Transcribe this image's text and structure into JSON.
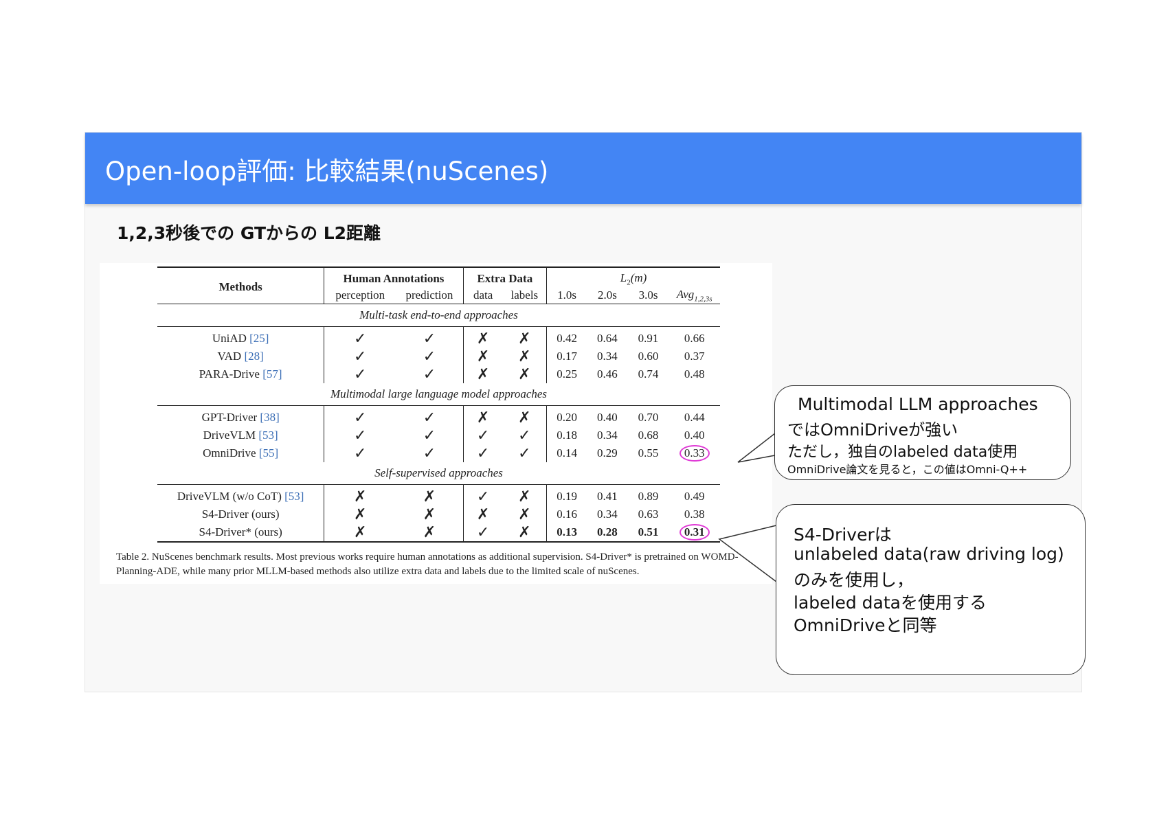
{
  "slide": {
    "title": "Open-loop評価: 比較結果(nuScenes)",
    "subtitle": "1,2,3秒後での GTからの L2距離"
  },
  "table": {
    "header": {
      "methods": "Methods",
      "human_annotations": "Human Annotations",
      "perception": "perception",
      "prediction": "prediction",
      "extra_data": "Extra Data",
      "data": "data",
      "labels": "labels",
      "l2_prefix": "L",
      "l2_sub": "2",
      "l2_suffix": "(m)",
      "t1": "1.0s",
      "t2": "2.0s",
      "t3": "3.0s",
      "avg": "Avg",
      "avg_sub": "1,2,3s"
    },
    "sections": [
      {
        "title": "Multi-task end-to-end approaches",
        "rows": [
          {
            "method": "UniAD ",
            "ref": "[25]",
            "perception": "✓",
            "prediction": "✓",
            "data": "✗",
            "labels": "✗",
            "t1": "0.42",
            "t2": "0.64",
            "t3": "0.91",
            "avg": "0.66"
          },
          {
            "method": "VAD ",
            "ref": "[28]",
            "perception": "✓",
            "prediction": "✓",
            "data": "✗",
            "labels": "✗",
            "t1": "0.17",
            "t2": "0.34",
            "t3": "0.60",
            "avg": "0.37"
          },
          {
            "method": "PARA-Drive ",
            "ref": "[57]",
            "perception": "✓",
            "prediction": "✓",
            "data": "✗",
            "labels": "✗",
            "t1": "0.25",
            "t2": "0.46",
            "t3": "0.74",
            "avg": "0.48"
          }
        ]
      },
      {
        "title": "Multimodal large language model approaches",
        "rows": [
          {
            "method": "GPT-Driver ",
            "ref": "[38]",
            "perception": "✓",
            "prediction": "✓",
            "data": "✗",
            "labels": "✗",
            "t1": "0.20",
            "t2": "0.40",
            "t3": "0.70",
            "avg": "0.44"
          },
          {
            "method": "DriveVLM ",
            "ref": "[53]",
            "perception": "✓",
            "prediction": "✓",
            "data": "✓",
            "labels": "✓",
            "t1": "0.18",
            "t2": "0.34",
            "t3": "0.68",
            "avg": "0.40"
          },
          {
            "method": "OmniDrive ",
            "ref": "[55]",
            "perception": "✓",
            "prediction": "✓",
            "data": "✓",
            "labels": "✓",
            "t1": "0.14",
            "t2": "0.29",
            "t3": "0.55",
            "avg": "0.33"
          }
        ]
      },
      {
        "title": "Self-supervised approaches",
        "rows": [
          {
            "method": "DriveVLM (w/o CoT) ",
            "ref": "[53]",
            "perception": "✗",
            "prediction": "✗",
            "data": "✓",
            "labels": "✗",
            "t1": "0.19",
            "t2": "0.41",
            "t3": "0.89",
            "avg": "0.49"
          },
          {
            "method": "S4-Driver (ours)",
            "ref": "",
            "perception": "✗",
            "prediction": "✗",
            "data": "✗",
            "labels": "✗",
            "t1": "0.16",
            "t2": "0.34",
            "t3": "0.63",
            "avg": "0.38"
          },
          {
            "method": "S4-Driver* (ours)",
            "ref": "",
            "perception": "✗",
            "prediction": "✗",
            "data": "✓",
            "labels": "✗",
            "t1": "0.13",
            "t2": "0.28",
            "t3": "0.51",
            "avg": "0.31"
          }
        ]
      }
    ],
    "caption": "Table 2. NuScenes benchmark results. Most previous works require human annotations as additional supervision. S4-Driver* is pretrained on WOMD-Planning-ADE, while many prior MLLM-based methods also utilize extra data and labels due to the limited scale of nuScenes.",
    "highlight_color": "#e03ad6"
  },
  "callout1": {
    "line1": "Multimodal LLM approaches",
    "line2": "ではOmniDriveが強い",
    "line3": "ただし，独自のlabeled data使用",
    "line4": "OmniDrive論文を見ると，この値はOmni-Q++"
  },
  "callout2": {
    "line1": "S4-Driverは",
    "line2": "unlabeled data(raw driving log)",
    "line3": "のみを使用し，",
    "line4": "labeled dataを使用する",
    "line5": "OmniDriveと同等"
  },
  "colors": {
    "header_bg": "#4385f4",
    "header_text": "#ffffff",
    "ref_link": "#3a6db5"
  }
}
